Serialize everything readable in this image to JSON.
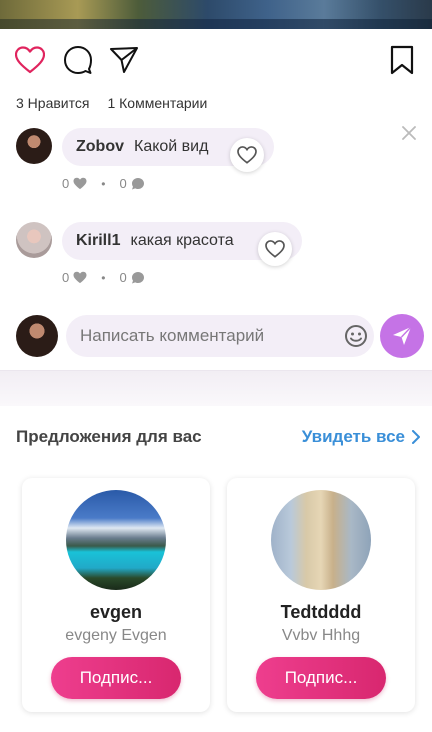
{
  "post": {
    "likes_text": "3 Нравится",
    "comments_text": "1 Комментарии"
  },
  "icons": {
    "like": "heart-outline-icon",
    "comment": "speech-bubble-icon",
    "share": "paper-plane-icon",
    "save": "bookmark-icon",
    "close": "close-icon"
  },
  "colors": {
    "like_heart": "#e0245e",
    "accent_send": "#c573e6",
    "see_all_link": "#3a8fd8",
    "subscribe_button": "#e2307c"
  },
  "comments": [
    {
      "author": "Zobov",
      "text": "Какой вид",
      "likes": "0",
      "replies": "0"
    },
    {
      "author": "Kirill1",
      "text": "какая красота",
      "likes": "0",
      "replies": "0"
    }
  ],
  "composer": {
    "placeholder": "Написать комментарий"
  },
  "suggestions": {
    "title": "Предложения для вас",
    "see_all": "Увидеть все",
    "cards": [
      {
        "username": "evgen",
        "full_name": "evgeny Evgen",
        "button": "Подпис..."
      },
      {
        "username": "Tedtdddd",
        "full_name": "Vvbv Hhhg",
        "button": "Подпис..."
      }
    ]
  }
}
